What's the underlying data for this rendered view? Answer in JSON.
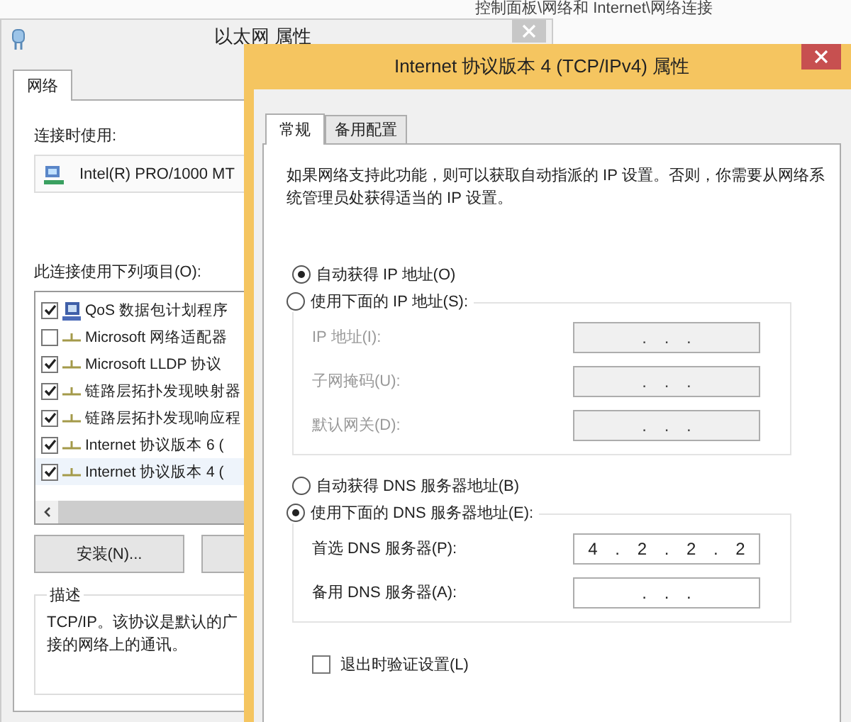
{
  "background_window": {
    "path": "控制面板\\网络和 Internet\\网络连接"
  },
  "ethernet_window": {
    "title": "以太网 属性",
    "tabs": [
      {
        "label": "网络",
        "selected": true
      }
    ],
    "connect_using_label": "连接时使用:",
    "adapter": "Intel(R) PRO/1000 MT",
    "items_label": "此连接使用下列项目(O):",
    "items": [
      {
        "label": "QoS 数据包计划程序",
        "checked": true,
        "kind": "scheduler"
      },
      {
        "label": "Microsoft 网络适配器",
        "checked": false,
        "kind": "protocol"
      },
      {
        "label": "Microsoft LLDP 协议",
        "checked": true,
        "kind": "protocol"
      },
      {
        "label": "链路层拓扑发现映射器",
        "checked": true,
        "kind": "protocol"
      },
      {
        "label": "链路层拓扑发现响应程",
        "checked": true,
        "kind": "protocol"
      },
      {
        "label": "Internet 协议版本 6 (",
        "checked": true,
        "kind": "protocol"
      },
      {
        "label": "Internet 协议版本 4 (",
        "checked": true,
        "kind": "protocol",
        "selected": true
      }
    ],
    "install_button": "安装(N)...",
    "description": {
      "title": "描述",
      "lines": [
        "TCP/IP。该协议是默认的广",
        "接的网络上的通讯。"
      ]
    }
  },
  "ipv4_window": {
    "title": "Internet 协议版本 4 (TCP/IPv4) 属性",
    "tabs": [
      {
        "label": "常规",
        "selected": true
      },
      {
        "label": "备用配置",
        "selected": false
      }
    ],
    "intro": "如果网络支持此功能，则可以获取自动指派的 IP 设置。否则，你需要从网络系统管理员处获得适当的 IP 设置。",
    "ip_auto": {
      "label": "自动获得 IP 地址(O)",
      "selected": true
    },
    "ip_manual": {
      "label": "使用下面的 IP 地址(S):",
      "selected": false,
      "fields": [
        {
          "label": "IP 地址(I):",
          "value": ". . .",
          "disabled": true
        },
        {
          "label": "子网掩码(U):",
          "value": ". . .",
          "disabled": true
        },
        {
          "label": "默认网关(D):",
          "value": ". . .",
          "disabled": true
        }
      ]
    },
    "dns_auto": {
      "label": "自动获得 DNS 服务器地址(B)",
      "selected": false
    },
    "dns_manual": {
      "label": "使用下面的 DNS 服务器地址(E):",
      "selected": true,
      "fields": [
        {
          "label": "首选 DNS 服务器(P):",
          "value": "4 . 2 . 2 . 2",
          "disabled": false
        },
        {
          "label": "备用 DNS 服务器(A):",
          "value": ". . .",
          "disabled": false
        }
      ]
    },
    "validate_on_exit": {
      "label": "退出时验证设置(L)",
      "checked": false
    }
  }
}
